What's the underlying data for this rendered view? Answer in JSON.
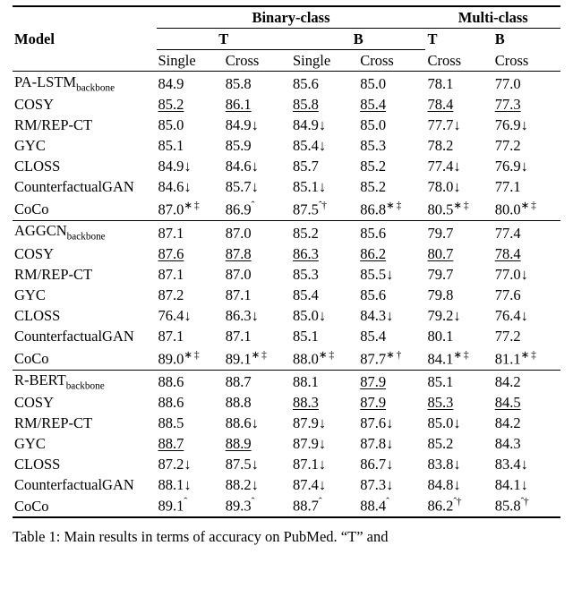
{
  "chart_data": {
    "type": "table",
    "title": "Table 1: Main results in terms of accuracy on PubMed. \"T\" and",
    "columns": [
      "Model",
      "Binary-class T Single",
      "Binary-class T Cross",
      "Binary-class B Single",
      "Binary-class B Cross",
      "Multi-class T Cross",
      "Multi-class B Cross"
    ],
    "groups": [
      {
        "rows": [
          {
            "model": "PA-LSTM_backbone",
            "vals": [
              "84.9",
              "85.8",
              "85.6",
              "85.0",
              "78.1",
              "77.0"
            ]
          },
          {
            "model": "COSY",
            "vals": [
              "85.2",
              "86.1",
              "85.8",
              "85.4",
              "78.4",
              "77.3"
            ]
          },
          {
            "model": "RM/REP-CT",
            "vals": [
              "85.0",
              "84.9↓",
              "84.9↓",
              "85.0",
              "77.7↓",
              "76.9↓"
            ]
          },
          {
            "model": "GYC",
            "vals": [
              "85.1",
              "85.9",
              "85.4↓",
              "85.3",
              "78.2",
              "77.2"
            ]
          },
          {
            "model": "CLOSS",
            "vals": [
              "84.9↓",
              "84.6↓",
              "85.7",
              "85.2",
              "77.4↓",
              "76.9↓"
            ]
          },
          {
            "model": "CounterfactualGAN",
            "vals": [
              "84.6↓",
              "85.7↓",
              "85.1↓",
              "85.2",
              "78.0↓",
              "77.1"
            ]
          },
          {
            "model": "CoCo",
            "vals": [
              "87.0*‡",
              "86.9ˆ",
              "87.5ˆ†",
              "86.8*‡",
              "80.5*‡",
              "80.0*‡"
            ]
          }
        ]
      },
      {
        "rows": [
          {
            "model": "AGGCN_backbone",
            "vals": [
              "87.1",
              "87.0",
              "85.2",
              "85.6",
              "79.7",
              "77.4"
            ]
          },
          {
            "model": "COSY",
            "vals": [
              "87.6",
              "87.8",
              "86.3",
              "86.2",
              "80.7",
              "78.4"
            ]
          },
          {
            "model": "RM/REP-CT",
            "vals": [
              "87.1",
              "87.0",
              "85.3",
              "85.5↓",
              "79.7",
              "77.0↓"
            ]
          },
          {
            "model": "GYC",
            "vals": [
              "87.2",
              "87.1",
              "85.4",
              "85.6",
              "79.8",
              "77.6"
            ]
          },
          {
            "model": "CLOSS",
            "vals": [
              "76.4↓",
              "86.3↓",
              "85.0↓",
              "84.3↓",
              "79.2↓",
              "76.4↓"
            ]
          },
          {
            "model": "CounterfactualGAN",
            "vals": [
              "87.1",
              "87.1",
              "85.1",
              "85.4",
              "80.1",
              "77.2"
            ]
          },
          {
            "model": "CoCo",
            "vals": [
              "89.0*‡",
              "89.1*‡",
              "88.0*‡",
              "87.7*†",
              "84.1*‡",
              "81.1*‡"
            ]
          }
        ]
      },
      {
        "rows": [
          {
            "model": "R-BERT_backbone",
            "vals": [
              "88.6",
              "88.7",
              "88.1",
              "87.9",
              "85.1",
              "84.2"
            ]
          },
          {
            "model": "COSY",
            "vals": [
              "88.6",
              "88.8",
              "88.3",
              "87.9",
              "85.3",
              "84.5"
            ]
          },
          {
            "model": "RM/REP-CT",
            "vals": [
              "88.5",
              "88.6↓",
              "87.9↓",
              "87.6↓",
              "85.0↓",
              "84.2"
            ]
          },
          {
            "model": "GYC",
            "vals": [
              "88.7",
              "88.9",
              "87.9↓",
              "87.8↓",
              "85.2",
              "84.3"
            ]
          },
          {
            "model": "CLOSS",
            "vals": [
              "87.2↓",
              "87.5↓",
              "87.1↓",
              "86.7↓",
              "83.8↓",
              "83.4↓"
            ]
          },
          {
            "model": "CounterfactualGAN",
            "vals": [
              "88.1↓",
              "88.2↓",
              "87.4↓",
              "87.3↓",
              "84.8↓",
              "84.1↓"
            ]
          },
          {
            "model": "CoCo",
            "vals": [
              "89.1ˆ",
              "89.3ˆ",
              "88.7ˆ",
              "88.4ˆ",
              "86.2ˆ†",
              "85.8ˆ†"
            ]
          }
        ]
      }
    ]
  },
  "headers": {
    "model": "Model",
    "binary": "Binary-class",
    "multi": "Multi-class",
    "T": "T",
    "B": "B",
    "single": "Single",
    "cross": "Cross"
  },
  "labels": {
    "backbone_sub": "backbone",
    "PA_LSTM": "PA-LSTM",
    "COSY": "COSY",
    "RMREPCT": "RM/REP-CT",
    "GYC": "GYC",
    "CLOSS": "CLOSS",
    "CGAN": "CounterfactualGAN",
    "CoCo": "CoCo",
    "AGGCN": "AGGCN",
    "RBERT": "R-BERT"
  },
  "g1": {
    "r0": {
      "c0": "84.9",
      "c1": "85.8",
      "c2": "85.6",
      "c3": "85.0",
      "c4": "78.1",
      "c5": "77.0"
    },
    "r1": {
      "c0": "85.2",
      "c1": "86.1",
      "c2": "85.8",
      "c3": "85.4",
      "c4": "78.4",
      "c5": "77.3"
    },
    "r2": {
      "c0": "85.0",
      "c1": "84.9↓",
      "c2": "84.9↓",
      "c3": "85.0",
      "c4": "77.7↓",
      "c5": "76.9↓"
    },
    "r3": {
      "c0": "85.1",
      "c1": "85.9",
      "c2": "85.4↓",
      "c3": "85.3",
      "c4": "78.2",
      "c5": "77.2"
    },
    "r4": {
      "c0": "84.9↓",
      "c1": "84.6↓",
      "c2": "85.7",
      "c3": "85.2",
      "c4": "77.4↓",
      "c5": "76.9↓"
    },
    "r5": {
      "c0": "84.6↓",
      "c1": "85.7↓",
      "c2": "85.1↓",
      "c3": "85.2",
      "c4": "78.0↓",
      "c5": "77.1"
    },
    "r6": {
      "c0v": "87.0",
      "c0m": "∗ ‡",
      "c1v": "86.9",
      "c1m": "ˆ",
      "c2v": "87.5",
      "c2m": "ˆ†",
      "c3v": "86.8",
      "c3m": "∗ ‡",
      "c4v": "80.5",
      "c4m": "∗ ‡",
      "c5v": "80.0",
      "c5m": "∗ ‡"
    }
  },
  "g2": {
    "r0": {
      "c0": "87.1",
      "c1": "87.0",
      "c2": "85.2",
      "c3": "85.6",
      "c4": "79.7",
      "c5": "77.4"
    },
    "r1": {
      "c0": "87.6",
      "c1": "87.8",
      "c2": "86.3",
      "c3": "86.2",
      "c4": "80.7",
      "c5": "78.4"
    },
    "r2": {
      "c0": "87.1",
      "c1": "87.0",
      "c2": "85.3",
      "c3": "85.5↓",
      "c4": "79.7",
      "c5": "77.0↓"
    },
    "r3": {
      "c0": "87.2",
      "c1": "87.1",
      "c2": "85.4",
      "c3": "85.6",
      "c4": "79.8",
      "c5": "77.6"
    },
    "r4": {
      "c0": "76.4↓",
      "c1": "86.3↓",
      "c2": "85.0↓",
      "c3": "84.3↓",
      "c4": "79.2↓",
      "c5": "76.4↓"
    },
    "r5": {
      "c0": "87.1",
      "c1": "87.1",
      "c2": "85.1",
      "c3": "85.4",
      "c4": "80.1",
      "c5": "77.2"
    },
    "r6": {
      "c0v": "89.0",
      "c0m": "∗ ‡",
      "c1v": "89.1",
      "c1m": "∗ ‡",
      "c2v": "88.0",
      "c2m": "∗ ‡",
      "c3v": "87.7",
      "c3m": "∗ †",
      "c4v": "84.1",
      "c4m": "∗ ‡",
      "c5v": "81.1",
      "c5m": "∗ ‡"
    }
  },
  "g3": {
    "r0": {
      "c0": "88.6",
      "c1": "88.7",
      "c2": "88.1",
      "c3": "87.9",
      "c4": "85.1",
      "c5": "84.2"
    },
    "r1": {
      "c0": "88.6",
      "c1": "88.8",
      "c2": "88.3",
      "c3": "87.9",
      "c4": "85.3",
      "c5": "84.5"
    },
    "r2": {
      "c0": "88.5",
      "c1": "88.6↓",
      "c2": "87.9↓",
      "c3": "87.6↓",
      "c4": "85.0↓",
      "c5": "84.2"
    },
    "r3": {
      "c0": "88.7",
      "c1": "88.9",
      "c2": "87.9↓",
      "c3": "87.8↓",
      "c4": "85.2",
      "c5": "84.3"
    },
    "r4": {
      "c0": "87.2↓",
      "c1": "87.5↓",
      "c2": "87.1↓",
      "c3": "86.7↓",
      "c4": "83.8↓",
      "c5": "83.4↓"
    },
    "r5": {
      "c0": "88.1↓",
      "c1": "88.2↓",
      "c2": "87.4↓",
      "c3": "87.3↓",
      "c4": "84.8↓",
      "c5": "84.1↓"
    },
    "r6": {
      "c0v": "89.1",
      "c0m": "ˆ",
      "c1v": "89.3",
      "c1m": "ˆ",
      "c2v": "88.7",
      "c2m": "ˆ",
      "c3v": "88.4",
      "c3m": "ˆ",
      "c4v": "86.2",
      "c4m": "ˆ†",
      "c5v": "85.8",
      "c5m": "ˆ†"
    }
  },
  "caption": "Table 1:  Main results in terms of accuracy on PubMed.  “T” and"
}
